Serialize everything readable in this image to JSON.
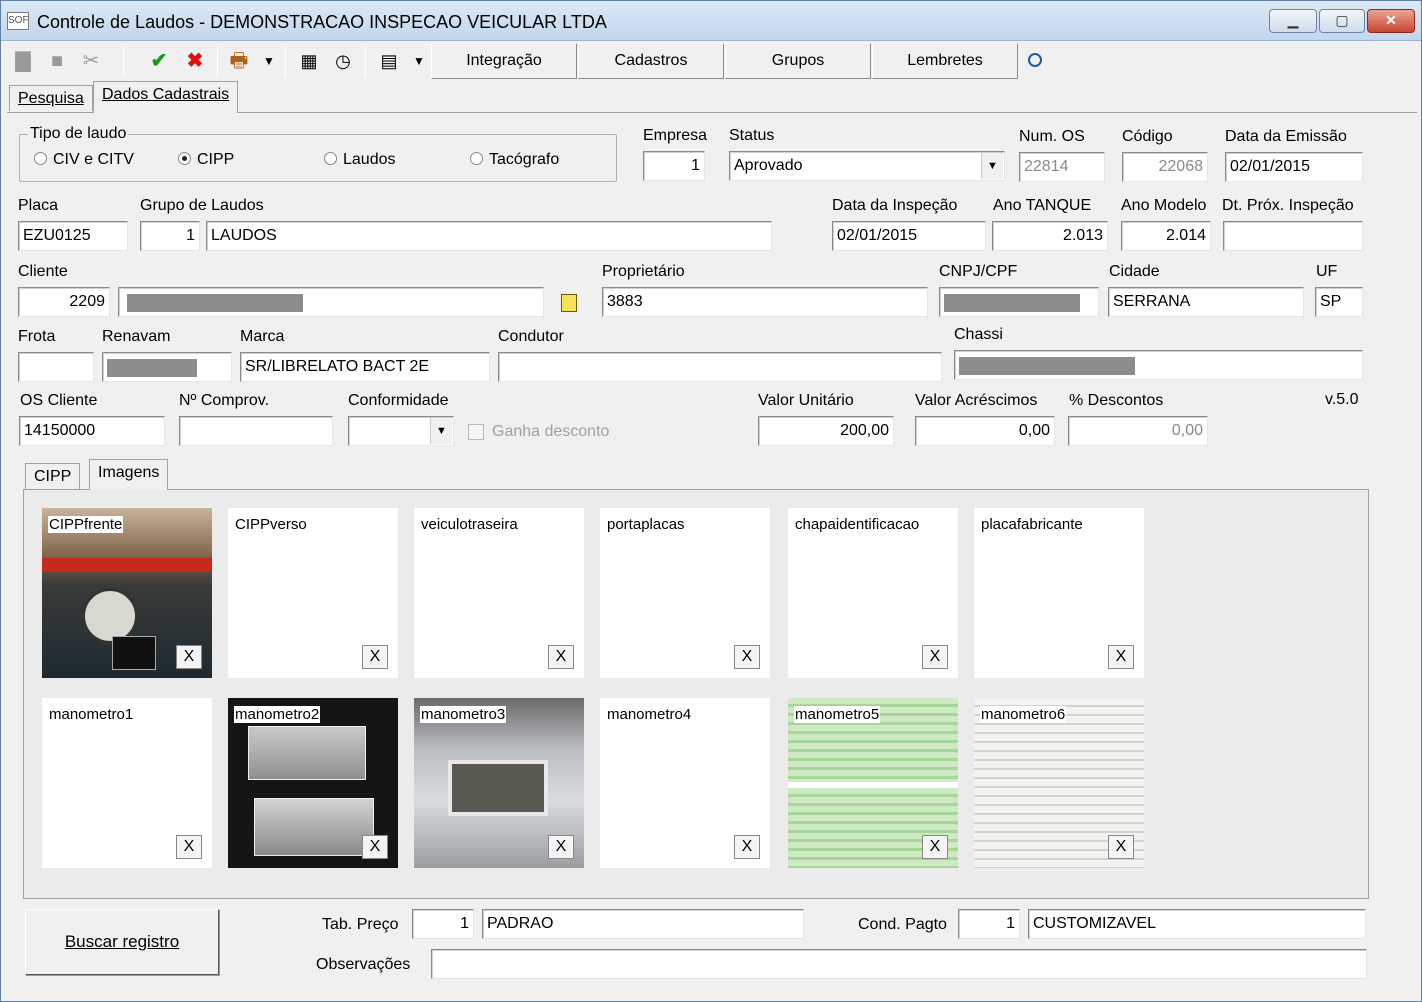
{
  "window": {
    "title": "Controle de Laudos - DEMONSTRACAO INSPECAO VEICULAR LTDA",
    "icon_text": "SOF"
  },
  "toolbar": {
    "integracao": "Integração",
    "cadastros": "Cadastros",
    "grupos": "Grupos",
    "lembretes": "Lembretes"
  },
  "tabs": {
    "pesquisa": "Pesquisa",
    "dados": "Dados Cadastrais"
  },
  "tipo": {
    "legend": "Tipo de laudo",
    "opts": [
      "CIV e CITV",
      "CIPP",
      "Laudos",
      "Tacógrafo"
    ],
    "selected": "CIPP"
  },
  "labels": {
    "empresa": "Empresa",
    "status": "Status",
    "num_os": "Num. OS",
    "codigo": "Código",
    "data_emissao": "Data da Emissão",
    "placa": "Placa",
    "grupo": "Grupo de Laudos",
    "data_insp": "Data da Inspeção",
    "ano_tanque": "Ano TANQUE",
    "ano_modelo": "Ano Modelo",
    "dt_prox": "Dt. Próx. Inspeção",
    "cliente": "Cliente",
    "proprietario": "Proprietário",
    "cnpj": "CNPJ/CPF",
    "cidade": "Cidade",
    "uf": "UF",
    "frota": "Frota",
    "renavam": "Renavam",
    "marca": "Marca",
    "condutor": "Condutor",
    "chassi": "Chassi",
    "os_cliente": "OS Cliente",
    "comprov": "Nº Comprov.",
    "conformidade": "Conformidade",
    "ganha": "Ganha desconto",
    "valor_unit": "Valor Unitário",
    "valor_acr": "Valor Acréscimos",
    "descontos": "% Descontos",
    "version": "v.5.0",
    "tab_preco": "Tab. Preço",
    "cond_pagto": "Cond. Pagto",
    "observacoes": "Observações"
  },
  "values": {
    "empresa": "1",
    "status": "Aprovado",
    "num_os": "22814",
    "codigo": "22068",
    "data_emissao": "02/01/2015",
    "placa": "EZU0125",
    "grupo_cod": "1",
    "grupo_nome": "LAUDOS",
    "data_insp": "02/01/2015",
    "ano_tanque": "2.013",
    "ano_modelo": "2.014",
    "dt_prox": "",
    "cliente_cod": "2209",
    "proprietario": "3883",
    "cidade": "SERRANA",
    "uf": "SP",
    "frota": "",
    "marca": "SR/LIBRELATO BACT 2E",
    "condutor": "",
    "os_cliente": "14150000",
    "comprov": "",
    "valor_unit": "200,00",
    "valor_acr": "0,00",
    "descontos": "0,00",
    "tab_preco_cod": "1",
    "tab_preco_nome": "PADRAO",
    "cond_pagto_cod": "1",
    "cond_pagto_nome": "CUSTOMIZAVEL",
    "observacoes": ""
  },
  "subtabs": {
    "cipp": "CIPP",
    "imagens": "Imagens"
  },
  "images": [
    "CIPPfrente",
    "CIPPverso",
    "veiculotraseira",
    "portaplacas",
    "chapaidentificacao",
    "placafabricante",
    "manometro1",
    "manometro2",
    "manometro3",
    "manometro4",
    "manometro5",
    "manometro6"
  ],
  "remove_label": "X",
  "buscar": "Buscar registro"
}
